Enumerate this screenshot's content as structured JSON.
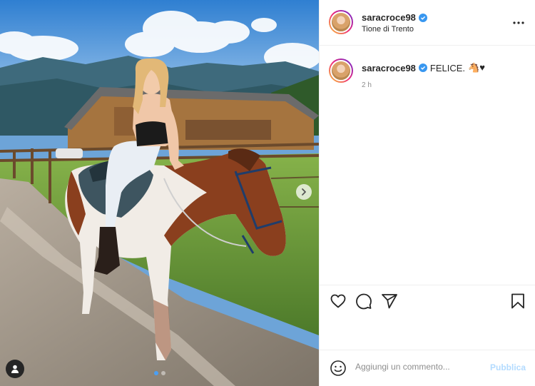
{
  "post": {
    "username": "saracroce98",
    "verified": true,
    "location": "Tione di Trento",
    "caption": "FELICE.",
    "caption_emoji": "🐴♥",
    "timestamp": "2 h",
    "carousel_total": 2,
    "carousel_active": 1
  },
  "comment": {
    "placeholder": "Aggiungi un commento...",
    "publish_label": "Pubblica"
  },
  "icons": {
    "more": "more-horizontal-icon",
    "like": "heart-icon",
    "comment": "comment-icon",
    "share": "share-icon",
    "save": "bookmark-icon",
    "emoji": "emoji-icon",
    "next": "chevron-right-icon",
    "tag": "user-tag-icon"
  },
  "colors": {
    "verified": "#3897f0",
    "publish_disabled": "#b3dbff",
    "carousel_active": "#4a9ff5"
  }
}
